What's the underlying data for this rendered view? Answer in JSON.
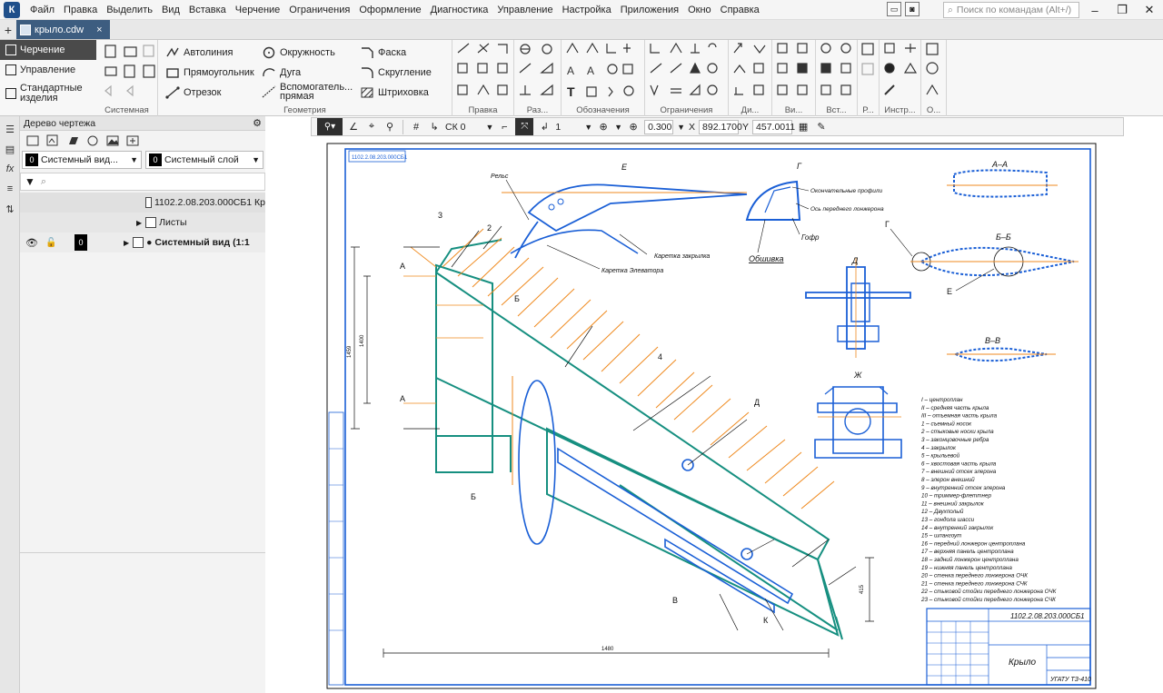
{
  "menubar": {
    "items": [
      "Файл",
      "Правка",
      "Выделить",
      "Вид",
      "Вставка",
      "Черчение",
      "Ограничения",
      "Оформление",
      "Диагностика",
      "Управление",
      "Настройка",
      "Приложения",
      "Окно",
      "Справка"
    ],
    "search_placeholder": "Поиск по командам (Alt+/)",
    "logo": "К"
  },
  "tabs": {
    "add": "+",
    "active": "крыло.cdw",
    "close": "×"
  },
  "ribbon": {
    "nav": [
      "Черчение",
      "Управление",
      "Стандартные изделия"
    ],
    "groups": {
      "system": "Системная",
      "geometry": "Геометрия",
      "edit": "Правка",
      "razm": "Раз...",
      "notation": "Обозначения",
      "limits": "Ограничения",
      "view": "Ди...",
      "vi": "Ви...",
      "insert": "Вст...",
      "r": "Р...",
      "tools": "Инстр...",
      "o": "О..."
    },
    "commands": {
      "autoline": "Автолиния",
      "rectangle": "Прямоугольник",
      "segment": "Отрезок",
      "circle": "Окружность",
      "arc": "Дуга",
      "aux_line": "Вспомогатель... прямая",
      "chamfer": "Фаска",
      "fillet": "Скругление",
      "hatch": "Штриховка"
    }
  },
  "tree": {
    "title": "Дерево чертежа",
    "view_select": "Системный вид...",
    "layer_select": "Системный слой",
    "view_num": "0",
    "layer_num": "0",
    "row_doc": "1102.2.08.203.000СБ1 Кр",
    "row_sheets": "Листы",
    "row_view": "● Системный вид (1:1",
    "vnum": "0"
  },
  "floatbar": {
    "cs": "СК 0",
    "scale_step": "1",
    "zoom": "0.300",
    "x_label": "X",
    "x_value": "892.1700",
    "y_label": "Y",
    "y_value": "457.0011"
  },
  "drawing": {
    "title_block": {
      "code": "1102.2.08.203.000СБ1",
      "name": "Крыло",
      "org": "УГАТУ ТЗ-410",
      "top_code": "1102.2.08.203.000СБ1"
    },
    "section_labels": [
      "Е",
      "Г",
      "А–А",
      "Б–Б",
      "В–В",
      "Д",
      "Ж"
    ],
    "callouts": {
      "rail": "Рельс",
      "carriage": "Каретка закрылка",
      "carriage_slat": "Каретка Элеватора",
      "skin": "Обшивка",
      "corrugation": "Гофр",
      "contour": "Окончательные профили",
      "axis": "Ось переднего лонжерона"
    },
    "spec": [
      "I – центроплан",
      "II – средняя часть крыла",
      "III – отъемная часть крыла",
      "1 – съемный носок",
      "2 – стыковые носки крыла",
      "3 – законцовочные ребра",
      "4 – закрылок",
      "5 – крыльевой",
      "6 – хвостовая часть крыла",
      "7 – внешний отсек элерона",
      "8 – элерон внешний",
      "9 – внутренний отсек элерона",
      "10 – триммер-флеттнер",
      "11 – внешний закрылок",
      "12 – Двухполый",
      "13 – гондола шасси",
      "14 – внутренний закрылок",
      "15 – шпангоут",
      "16 – передний лонжерон центроплана",
      "17 – верхняя панель центроплана",
      "18 – задний лонжерон центроплана",
      "19 – нижняя панель центроплана",
      "20 – стенка переднего лонжерона ОЧК",
      "21 – стенка переднего лонжерона СЧК",
      "22 – стыковой стойки переднего лонжерона ОЧК",
      "23 – стыковой стойки переднего лонжерона СЧК"
    ],
    "dims": {
      "span": "1480",
      "root": "1400",
      "chord": "1459",
      "tip": "415"
    },
    "markers": [
      "А",
      "А",
      "Б",
      "Б",
      "В",
      "К",
      "Г",
      "Д",
      "Е",
      "2",
      "3",
      "4"
    ]
  },
  "colors": {
    "accent": "#3d5d80",
    "teal": "#168f80",
    "orange": "#ef8a1f",
    "blue": "#1a5fd6"
  }
}
